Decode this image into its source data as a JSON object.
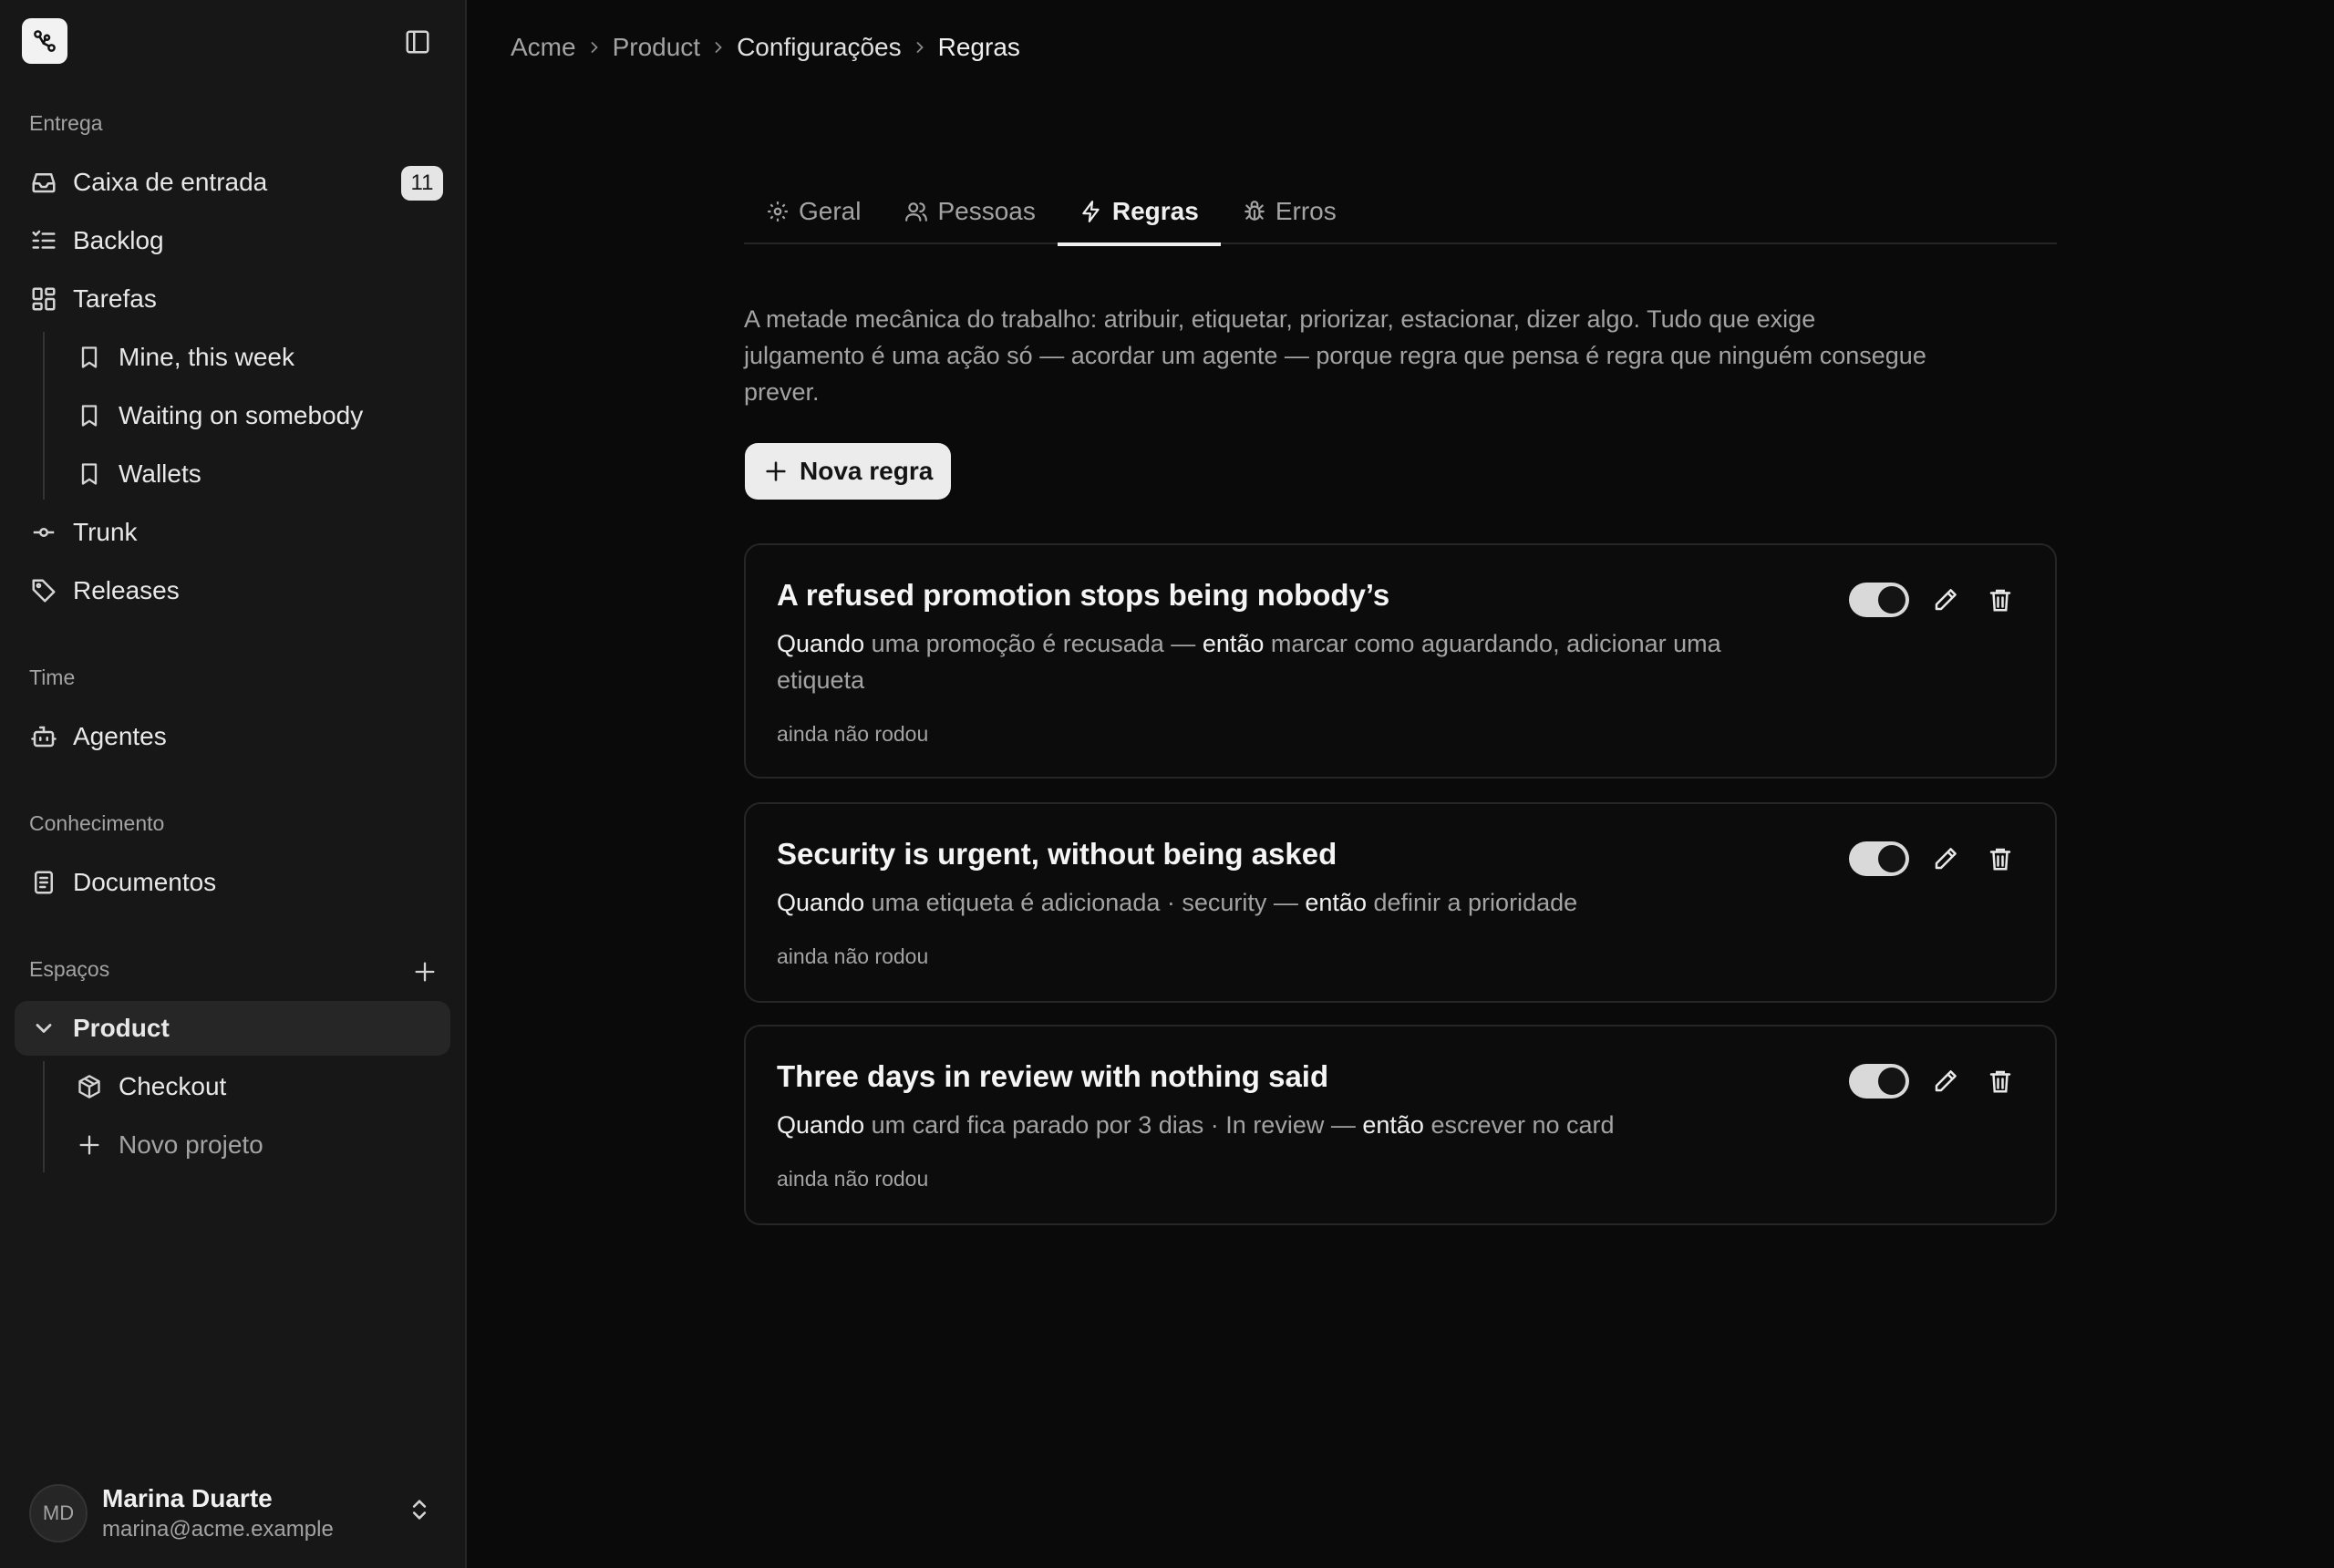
{
  "sidebar": {
    "sections": {
      "delivery": "Entrega",
      "team": "Time",
      "knowledge": "Conhecimento",
      "spaces": "Espaços"
    },
    "inbox": {
      "label": "Caixa de entrada",
      "badge": "11"
    },
    "backlog": "Backlog",
    "tasks": "Tarefas",
    "saved_views": [
      "Mine, this week",
      "Waiting on somebody",
      "Wallets"
    ],
    "trunk": "Trunk",
    "releases": "Releases",
    "agents": "Agentes",
    "documents": "Documentos",
    "space_product": "Product",
    "project_checkout": "Checkout",
    "new_project": "Novo projeto",
    "user": {
      "initials": "MD",
      "name": "Marina Duarte",
      "email": "marina@acme.example"
    }
  },
  "breadcrumb": [
    "Acme",
    "Product",
    "Configurações",
    "Regras"
  ],
  "tabs": [
    {
      "label": "Geral",
      "icon": "gear-icon"
    },
    {
      "label": "Pessoas",
      "icon": "users-icon"
    },
    {
      "label": "Regras",
      "icon": "lightning-icon",
      "active": true
    },
    {
      "label": "Erros",
      "icon": "bug-icon"
    }
  ],
  "intro": "A metade mecânica do trabalho: atribuir, etiquetar, priorizar, estacionar, dizer algo. Tudo que exige julgamento é uma ação só — acordar um agente — porque regra que pensa é regra que ninguém consegue prever.",
  "new_rule_label": "Nova regra",
  "rules": [
    {
      "title": "A refused promotion stops being nobody’s",
      "when_kw": "Quando",
      "when": "uma promoção é recusada —",
      "then_kw": "então",
      "then": "marcar como aguardando, adicionar uma etiqueta",
      "meta": "ainda não rodou",
      "enabled": true
    },
    {
      "title": "Security is urgent, without being asked",
      "when_kw": "Quando",
      "when": "uma etiqueta é adicionada · security —",
      "then_kw": "então",
      "then": "definir a prioridade",
      "meta": "ainda não rodou",
      "enabled": true
    },
    {
      "title": "Three days in review with nothing said",
      "when_kw": "Quando",
      "when": "um card fica parado por 3 dias · In review —",
      "then_kw": "então",
      "then": "escrever no card",
      "meta": "ainda não rodou",
      "enabled": true
    }
  ]
}
